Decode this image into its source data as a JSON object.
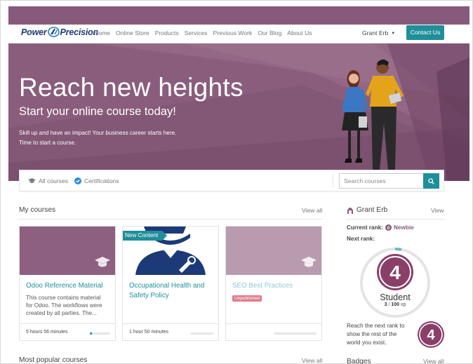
{
  "brand": {
    "logo_left": "Power",
    "logo_right": "Precision"
  },
  "nav": {
    "links": [
      "Home",
      "Online Store",
      "Products",
      "Services",
      "Previous Work",
      "Our Blog",
      "About Us"
    ],
    "user": "Grant Erb",
    "contact_label": "Contact Us"
  },
  "hero": {
    "title": "Reach new heights",
    "subtitle": "Start your online course today!",
    "text_line1": "Skill up and have an impact! Your business career starts here.",
    "text_line2": "Time to start a course."
  },
  "filters": {
    "all_courses": "All courses",
    "certifications": "Certifications",
    "search_placeholder": "Search courses"
  },
  "my_courses": {
    "title": "My courses",
    "view_all": "View all",
    "cards": [
      {
        "title": "Odoo Reference Material",
        "desc_lines": [
          "This course contains material",
          "for Odoo. The workflows were",
          "created by all parties. The..."
        ],
        "duration": "5 hours 56 minutes",
        "progress": 0.1
      },
      {
        "badge": "New Content",
        "title_line1": "Occupational Health and",
        "title_line2": "Safety Policy",
        "duration": "1 hour 50 minutes",
        "progress": 0
      },
      {
        "title": "SEO Best Practices",
        "status": "Unpublished",
        "progress": 0
      }
    ]
  },
  "popular": {
    "title": "Most popular courses",
    "view_all": "View all"
  },
  "profile": {
    "name": "Grant Erb",
    "view_label": "View",
    "current_rank_label": "Current rank:",
    "current_rank": "Newbie",
    "next_rank_label": "Next rank:",
    "next_rank_level": "4",
    "next_rank_name": "Student",
    "xp_current": "3",
    "xp_sep": " / ",
    "xp_target": "100",
    "xp_unit": " xp",
    "xp_progress": 0.03,
    "reach_line1": "Reach the next rank to",
    "reach_line2": "show the rest of the",
    "reach_line3": "world you exist.",
    "badges_title": "Badges",
    "badges_view_all": "View all"
  },
  "colors": {
    "primary": "#875a7b",
    "accent": "#1f8f9a",
    "unpublished": "#e07a8a"
  }
}
